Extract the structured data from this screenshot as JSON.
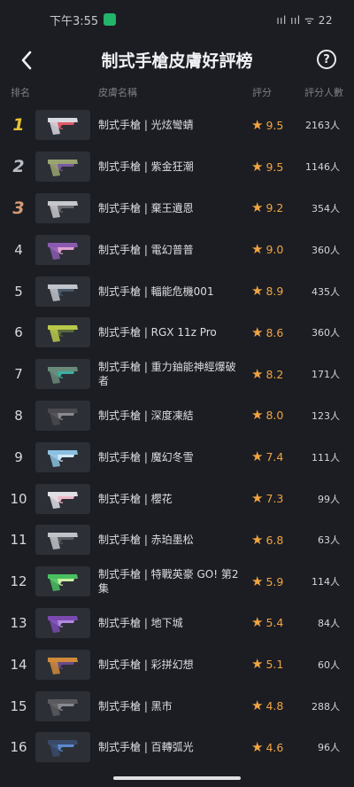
{
  "status": {
    "time": "下午3:55",
    "right_text": "ııl ııl ᯤ 22"
  },
  "header": {
    "title": "制式手槍皮膚好評榜",
    "help_label": "?"
  },
  "columns": {
    "rank": "排名",
    "name": "皮膚名稱",
    "score": "評分",
    "count": "評分人數"
  },
  "rows": [
    {
      "rank": "1",
      "name": "制式手槍 | 光炫彎蜻",
      "score": "9.5",
      "count": "2163人",
      "gun_color": "#d8d8e0",
      "accent": "#e05a6a"
    },
    {
      "rank": "2",
      "name": "制式手槍 | 紫金狂潮",
      "score": "9.5",
      "count": "1146人",
      "gun_color": "#9aa470",
      "accent": "#7a5aa0"
    },
    {
      "rank": "3",
      "name": "制式手槍 | 棄王遺恩",
      "score": "9.2",
      "count": "354人",
      "gun_color": "#c8c8cc",
      "accent": "#6a6a70"
    },
    {
      "rank": "4",
      "name": "制式手槍 | 電幻普普",
      "score": "9.0",
      "count": "360人",
      "gun_color": "#8a5ab0",
      "accent": "#e0a0d0"
    },
    {
      "rank": "5",
      "name": "制式手槍 | 輻能危機001",
      "score": "8.9",
      "count": "435人",
      "gun_color": "#c0c4cc",
      "accent": "#4a5a6a"
    },
    {
      "rank": "6",
      "name": "制式手槍 | RGX 11z Pro",
      "score": "8.6",
      "count": "360人",
      "gun_color": "#b8c84a",
      "accent": "#5a6a3a"
    },
    {
      "rank": "7",
      "name": "制式手槍 | 重力鈾能神經爆破者",
      "score": "8.2",
      "count": "171人",
      "gun_color": "#6a8a7a",
      "accent": "#3ab0a0"
    },
    {
      "rank": "8",
      "name": "制式手槍 | 深度凍結",
      "score": "8.0",
      "count": "123人",
      "gun_color": "#4a4a50",
      "accent": "#8a8a90"
    },
    {
      "rank": "9",
      "name": "制式手槍 | 魔幻冬雪",
      "score": "7.4",
      "count": "111人",
      "gun_color": "#8ac0e0",
      "accent": "#d0e8f8"
    },
    {
      "rank": "10",
      "name": "制式手槍 | 櫻花",
      "score": "7.3",
      "count": "99人",
      "gun_color": "#e0e0e4",
      "accent": "#f0b8c8"
    },
    {
      "rank": "11",
      "name": "制式手槍 | 赤珀墨松",
      "score": "6.8",
      "count": "63人",
      "gun_color": "#c0c4c8",
      "accent": "#5a5a60"
    },
    {
      "rank": "12",
      "name": "制式手槍 | 特戰英豪 GO! 第2集",
      "score": "5.9",
      "count": "114人",
      "gun_color": "#48c060",
      "accent": "#c8f0a0"
    },
    {
      "rank": "13",
      "name": "制式手槍 | 地下城",
      "score": "5.4",
      "count": "84人",
      "gun_color": "#7a4ab0",
      "accent": "#b08ae0"
    },
    {
      "rank": "14",
      "name": "制式手槍 | 彩拼幻想",
      "score": "5.1",
      "count": "60人",
      "gun_color": "#d08a3a",
      "accent": "#6a4a8a"
    },
    {
      "rank": "15",
      "name": "制式手槍 | 黑市",
      "score": "4.8",
      "count": "288人",
      "gun_color": "#5a5a5e",
      "accent": "#8a8a8e"
    },
    {
      "rank": "16",
      "name": "制式手槍 | 百轉弧光",
      "score": "4.6",
      "count": "96人",
      "gun_color": "#3a4a6a",
      "accent": "#5a8ad0"
    }
  ],
  "colors": {
    "background": "#1b1d23",
    "star": "#f2a441",
    "gold": "#e9c234",
    "silver": "#b8bcc4",
    "bronze": "#d69a73"
  }
}
